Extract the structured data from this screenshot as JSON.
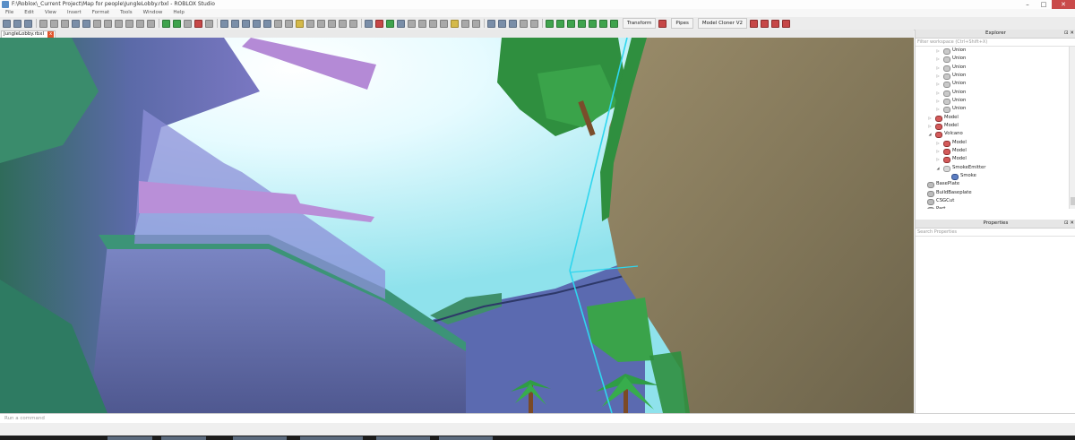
{
  "window": {
    "title": "F:\\Roblox\\_Current Project\\Map for people\\JungleLobby.rbxl - ROBLOX Studio",
    "minimize": "–",
    "maximize": "□",
    "close": "✕"
  },
  "menu": [
    "File",
    "Edit",
    "View",
    "Insert",
    "Format",
    "Tools",
    "Window",
    "Help"
  ],
  "toolbar": {
    "transform_label": "Transform",
    "pipes_label": "Pipes",
    "model_cloner_label": "Model Cloner V2"
  },
  "document_tab": {
    "label": "JungleLobby.rbxl",
    "close": "x"
  },
  "explorer": {
    "title": "Explorer",
    "filter_placeholder": "Filter workspace (Ctrl+Shift+X)",
    "header_buttons": "⊡ ✕",
    "items": [
      {
        "label": "Union",
        "depth": 2,
        "icon": "union-icon",
        "arrow": "▷"
      },
      {
        "label": "Union",
        "depth": 2,
        "icon": "union-icon",
        "arrow": "▷"
      },
      {
        "label": "Union",
        "depth": 2,
        "icon": "union-icon",
        "arrow": "▷"
      },
      {
        "label": "Union",
        "depth": 2,
        "icon": "union-icon",
        "arrow": "▷"
      },
      {
        "label": "Union",
        "depth": 2,
        "icon": "union-icon",
        "arrow": "▷"
      },
      {
        "label": "Union",
        "depth": 2,
        "icon": "union-icon",
        "arrow": "▷"
      },
      {
        "label": "Union",
        "depth": 2,
        "icon": "union-icon",
        "arrow": "▷"
      },
      {
        "label": "Union",
        "depth": 2,
        "icon": "union-icon",
        "arrow": "▷"
      },
      {
        "label": "Model",
        "depth": 1,
        "icon": "model-icon",
        "arrow": "▷"
      },
      {
        "label": "Model",
        "depth": 1,
        "icon": "model-icon",
        "arrow": "▷"
      },
      {
        "label": "Volcano",
        "depth": 1,
        "icon": "model-icon",
        "arrow": "◢"
      },
      {
        "label": "Model",
        "depth": 2,
        "icon": "model-icon",
        "arrow": "▷"
      },
      {
        "label": "Model",
        "depth": 2,
        "icon": "model-icon",
        "arrow": "▷"
      },
      {
        "label": "Model",
        "depth": 2,
        "icon": "model-icon",
        "arrow": "▷"
      },
      {
        "label": "SmokeEmitter",
        "depth": 2,
        "icon": "emitter-icon",
        "arrow": "◢"
      },
      {
        "label": "Smoke",
        "depth": 3,
        "icon": "smoke-icon",
        "arrow": ""
      },
      {
        "label": "BasePlate",
        "depth": 0,
        "icon": "part-icon",
        "arrow": ""
      },
      {
        "label": "BuildBaseplate",
        "depth": 0,
        "icon": "part-icon",
        "arrow": ""
      },
      {
        "label": "CSGCut",
        "depth": 0,
        "icon": "part-icon",
        "arrow": ""
      },
      {
        "label": "Part",
        "depth": 0,
        "icon": "part-icon",
        "arrow": ""
      }
    ]
  },
  "properties": {
    "title": "Properties",
    "search_placeholder": "Search Properties",
    "header_buttons": "⊡ ✕"
  },
  "command_bar": {
    "placeholder": "Run a command"
  },
  "colors": {
    "sky": "#9fe6ef",
    "cliff": "#8a7d5e",
    "selection": "#2fd6ee",
    "foliage": "#2f8f3f"
  }
}
